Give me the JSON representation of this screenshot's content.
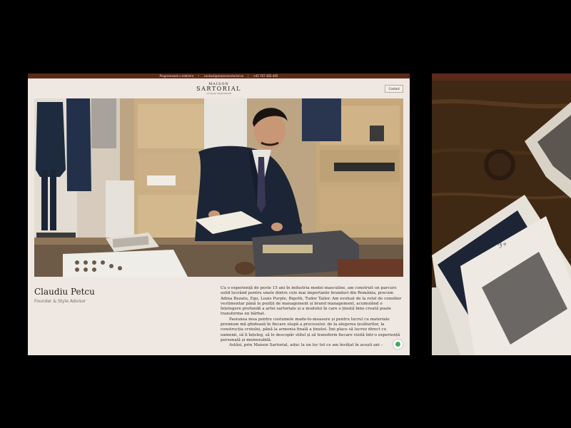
{
  "topbar": {
    "link1": "Programează o întâlnire",
    "separator": "•",
    "email": "contact@maisonsartorial.ro",
    "phone": "+40 767 465 495"
  },
  "header": {
    "logo_line1": "MAISON",
    "logo_line2": "SARTORIAL",
    "logo_tagline": "Croitorie după măsură",
    "contact_label": "Contact"
  },
  "person": {
    "name": "Claudiu Petcu",
    "role": "Founder & Style Advisor"
  },
  "bio": {
    "p1": "Cu o experiență de peste 15 ani în industria modei masculine, am construit un parcurs solid lucrând pentru unele dintre cele mai importante branduri din România, precum Adina Buzatu, Ego, Louis Purple, Bigotti, Tudor Tailor. Am evoluat de la rolul de consilier vestimentar până la poziții de management și brand management, acumulând o înțelegere profundă a artei sartoriale și a modului în care o ținută bine creată poate transforma un bărbat.",
    "p2": "Pasiunea mea pentru costumele made-to-measure și pentru lucrul cu materiale premium mă ghidează în fiecare etapă a procesului: de la alegerea țesăturilor, la construcția croiului, până la armonia finală a ținutei. Îmi place să lucrez direct cu oamenii, să îi înțeleg, să le descopăr stilul și să transform fiecare vizită într-o experiență personală și memorabilă.",
    "p3": "Astăzi, prin Maison Sartorial, aduc la un loc tot ce am învățat în acești ani –"
  },
  "colors": {
    "topbar": "#5b2a1a",
    "page_bg": "#efe7e2",
    "text": "#2a1d18",
    "chat_accent": "#3fae5a"
  },
  "icons": {
    "chat": "whatsapp-chat-icon"
  }
}
